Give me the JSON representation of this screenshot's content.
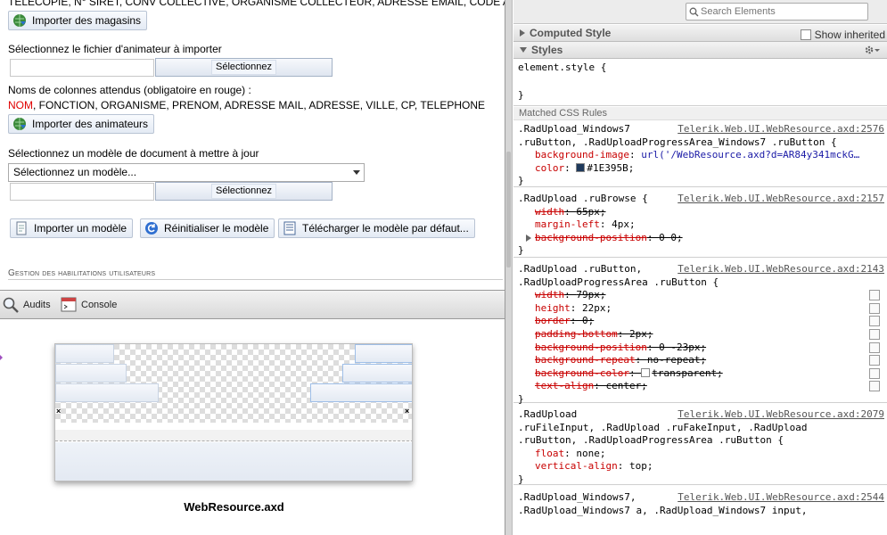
{
  "app": {
    "top_cut_text": "TÉLÉCOPIE, N° SIRET, CONV COLLECTIVE, ORGANISME COLLECTEUR, ADRESSE EMAIL, CODE APE.",
    "import_stores_button": "Importer des magasins",
    "animator_file_label": "Sélectionnez le fichier d'animateur à importer",
    "browse_label": "Sélectionnez",
    "columns_label": "Noms de colonnes attendus (obligatoire en rouge) :",
    "columns_required": "NOM",
    "columns_rest": ", FONCTION, ORGANISME, PRENOM, ADRESSE MAIL, ADRESSE, VILLE, CP, TELEPHONE",
    "import_animators_button": "Importer des animateurs",
    "template_label": "Sélectionnez un modèle de document à mettre à jour",
    "template_select_value": "Sélectionnez un modèle...",
    "import_template_button": "Importer un modèle",
    "reset_template_button": "Réinitialiser le modèle",
    "download_template_button": "Télécharger le modèle par défaut...",
    "section_title": "Gestion des habilitations utilisateurs"
  },
  "devtools": {
    "tabs": [
      {
        "label": "Audits",
        "icon": "audits-icon"
      },
      {
        "label": "Console",
        "icon": "console-icon"
      }
    ],
    "preview_caption": "WebResource.axd",
    "search_placeholder": "Search Elements",
    "computed_style_header": "Computed Style",
    "show_inherited_label": "Show inherited",
    "styles_header": "Styles",
    "element_style": "element.style {",
    "close_brace": "}",
    "matched_rules_header": "Matched CSS Rules",
    "rules": [
      {
        "selector_lines": [
          ".RadUpload_Windows7",
          ".ruButton, .RadUploadProgressArea_Windows7 .ruButton {"
        ],
        "source": "Telerik.Web.UI.WebResource.axd:2576",
        "props": [
          {
            "name": "background-image",
            "value": "url('/WebResource.axd?d=AR84y341mckG…",
            "strike": false
          },
          {
            "name": "color",
            "value": "#1E395B;",
            "strike": false,
            "swatch": "#1E395B"
          }
        ]
      },
      {
        "selector_lines": [
          ".RadUpload .ruBrowse {"
        ],
        "source": "Telerik.Web.UI.WebResource.axd:2157",
        "props": [
          {
            "name": "width",
            "value": "65px;",
            "strike": true
          },
          {
            "name": "margin-left",
            "value": "4px;",
            "strike": false
          },
          {
            "name": "background-position",
            "value": "0 0;",
            "strike": true,
            "expandable": true
          }
        ]
      },
      {
        "selector_lines": [
          ".RadUpload .ruButton,",
          ".RadUploadProgressArea .ruButton {"
        ],
        "source": "Telerik.Web.UI.WebResource.axd:2143",
        "props": [
          {
            "name": "width",
            "value": "79px;",
            "strike": true
          },
          {
            "name": "height",
            "value": "22px;",
            "strike": false
          },
          {
            "name": "border",
            "value": "0;",
            "strike": true
          },
          {
            "name": "padding-bottom",
            "value": "2px;",
            "strike": true
          },
          {
            "name": "background-position",
            "value": "0 -23px;",
            "strike": true
          },
          {
            "name": "background-repeat",
            "value": "no-repeat;",
            "strike": true
          },
          {
            "name": "background-color",
            "value": "transparent;",
            "strike": true,
            "swatch": "#ffffff"
          },
          {
            "name": "text-align",
            "value": "center;",
            "strike": true
          }
        ]
      },
      {
        "selector_lines": [
          ".RadUpload",
          ".ruFileInput, .RadUpload .ruFakeInput, .RadUpload",
          ".ruButton, .RadUploadProgressArea .ruButton {"
        ],
        "source": "Telerik.Web.UI.WebResource.axd:2079",
        "props": [
          {
            "name": "float",
            "value": "none;",
            "strike": false
          },
          {
            "name": "vertical-align",
            "value": "top;",
            "strike": false
          }
        ]
      },
      {
        "selector_lines": [
          ".RadUpload_Windows7,",
          ".RadUpload_Windows7 a, .RadUpload_Windows7 input,"
        ],
        "source": "Telerik.Web.UI.WebResource.axd:2544",
        "props": []
      }
    ]
  }
}
